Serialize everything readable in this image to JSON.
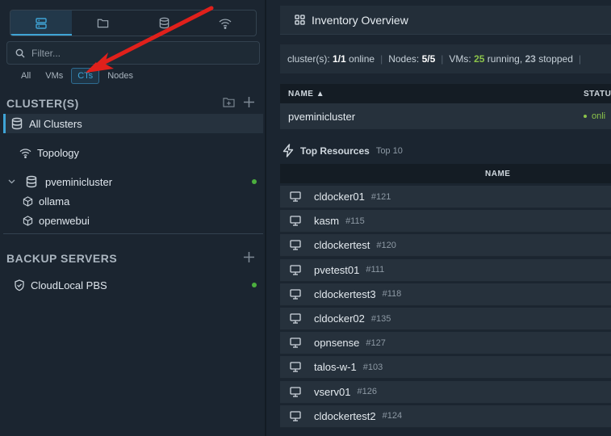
{
  "sidebar": {
    "view_tabs": [
      {
        "icon": "server-stack-icon",
        "active": true
      },
      {
        "icon": "folder-icon",
        "active": false
      },
      {
        "icon": "database-icon",
        "active": false
      },
      {
        "icon": "wifi-icon",
        "active": false
      }
    ],
    "filter_placeholder": "Filter...",
    "type_filters": [
      "All",
      "VMs",
      "CTs",
      "Nodes"
    ],
    "active_type_filter": "CTs",
    "clusters_title": "CLUSTER(S)",
    "tree": {
      "all_clusters": "All Clusters",
      "topology": "Topology",
      "cluster_name": "pveminicluster",
      "children": [
        "ollama",
        "openwebui"
      ]
    },
    "backup_title": "BACKUP SERVERS",
    "backup_server": "CloudLocal PBS"
  },
  "main": {
    "title": "Inventory Overview",
    "stats": {
      "clusters_label": "cluster(s):",
      "clusters_value": "1/1",
      "clusters_suffix": "online",
      "nodes_label": "Nodes:",
      "nodes_value": "5/5",
      "vms_label": "VMs:",
      "vms_running": "25",
      "running_label": "running,",
      "vms_stopped": "23",
      "stopped_label": "stopped"
    },
    "cluster_table": {
      "col_name": "NAME ▲",
      "col_status": "STATU",
      "row_name": "pveminicluster",
      "row_status": "onli"
    },
    "top_resources": {
      "title": "Top Resources",
      "subtitle": "Top 10",
      "col_name": "NAME",
      "rows": [
        {
          "name": "cldocker01",
          "id": "#121"
        },
        {
          "name": "kasm",
          "id": "#115"
        },
        {
          "name": "cldockertest",
          "id": "#120"
        },
        {
          "name": "pvetest01",
          "id": "#111"
        },
        {
          "name": "cldockertest3",
          "id": "#118"
        },
        {
          "name": "cldocker02",
          "id": "#135"
        },
        {
          "name": "opnsense",
          "id": "#127"
        },
        {
          "name": "talos-w-1",
          "id": "#103"
        },
        {
          "name": "vserv01",
          "id": "#126"
        },
        {
          "name": "cldockertest2",
          "id": "#124"
        }
      ]
    }
  },
  "colors": {
    "accent": "#3fa4d6",
    "online": "#4caf3e",
    "annotation_arrow": "#e0201b"
  }
}
